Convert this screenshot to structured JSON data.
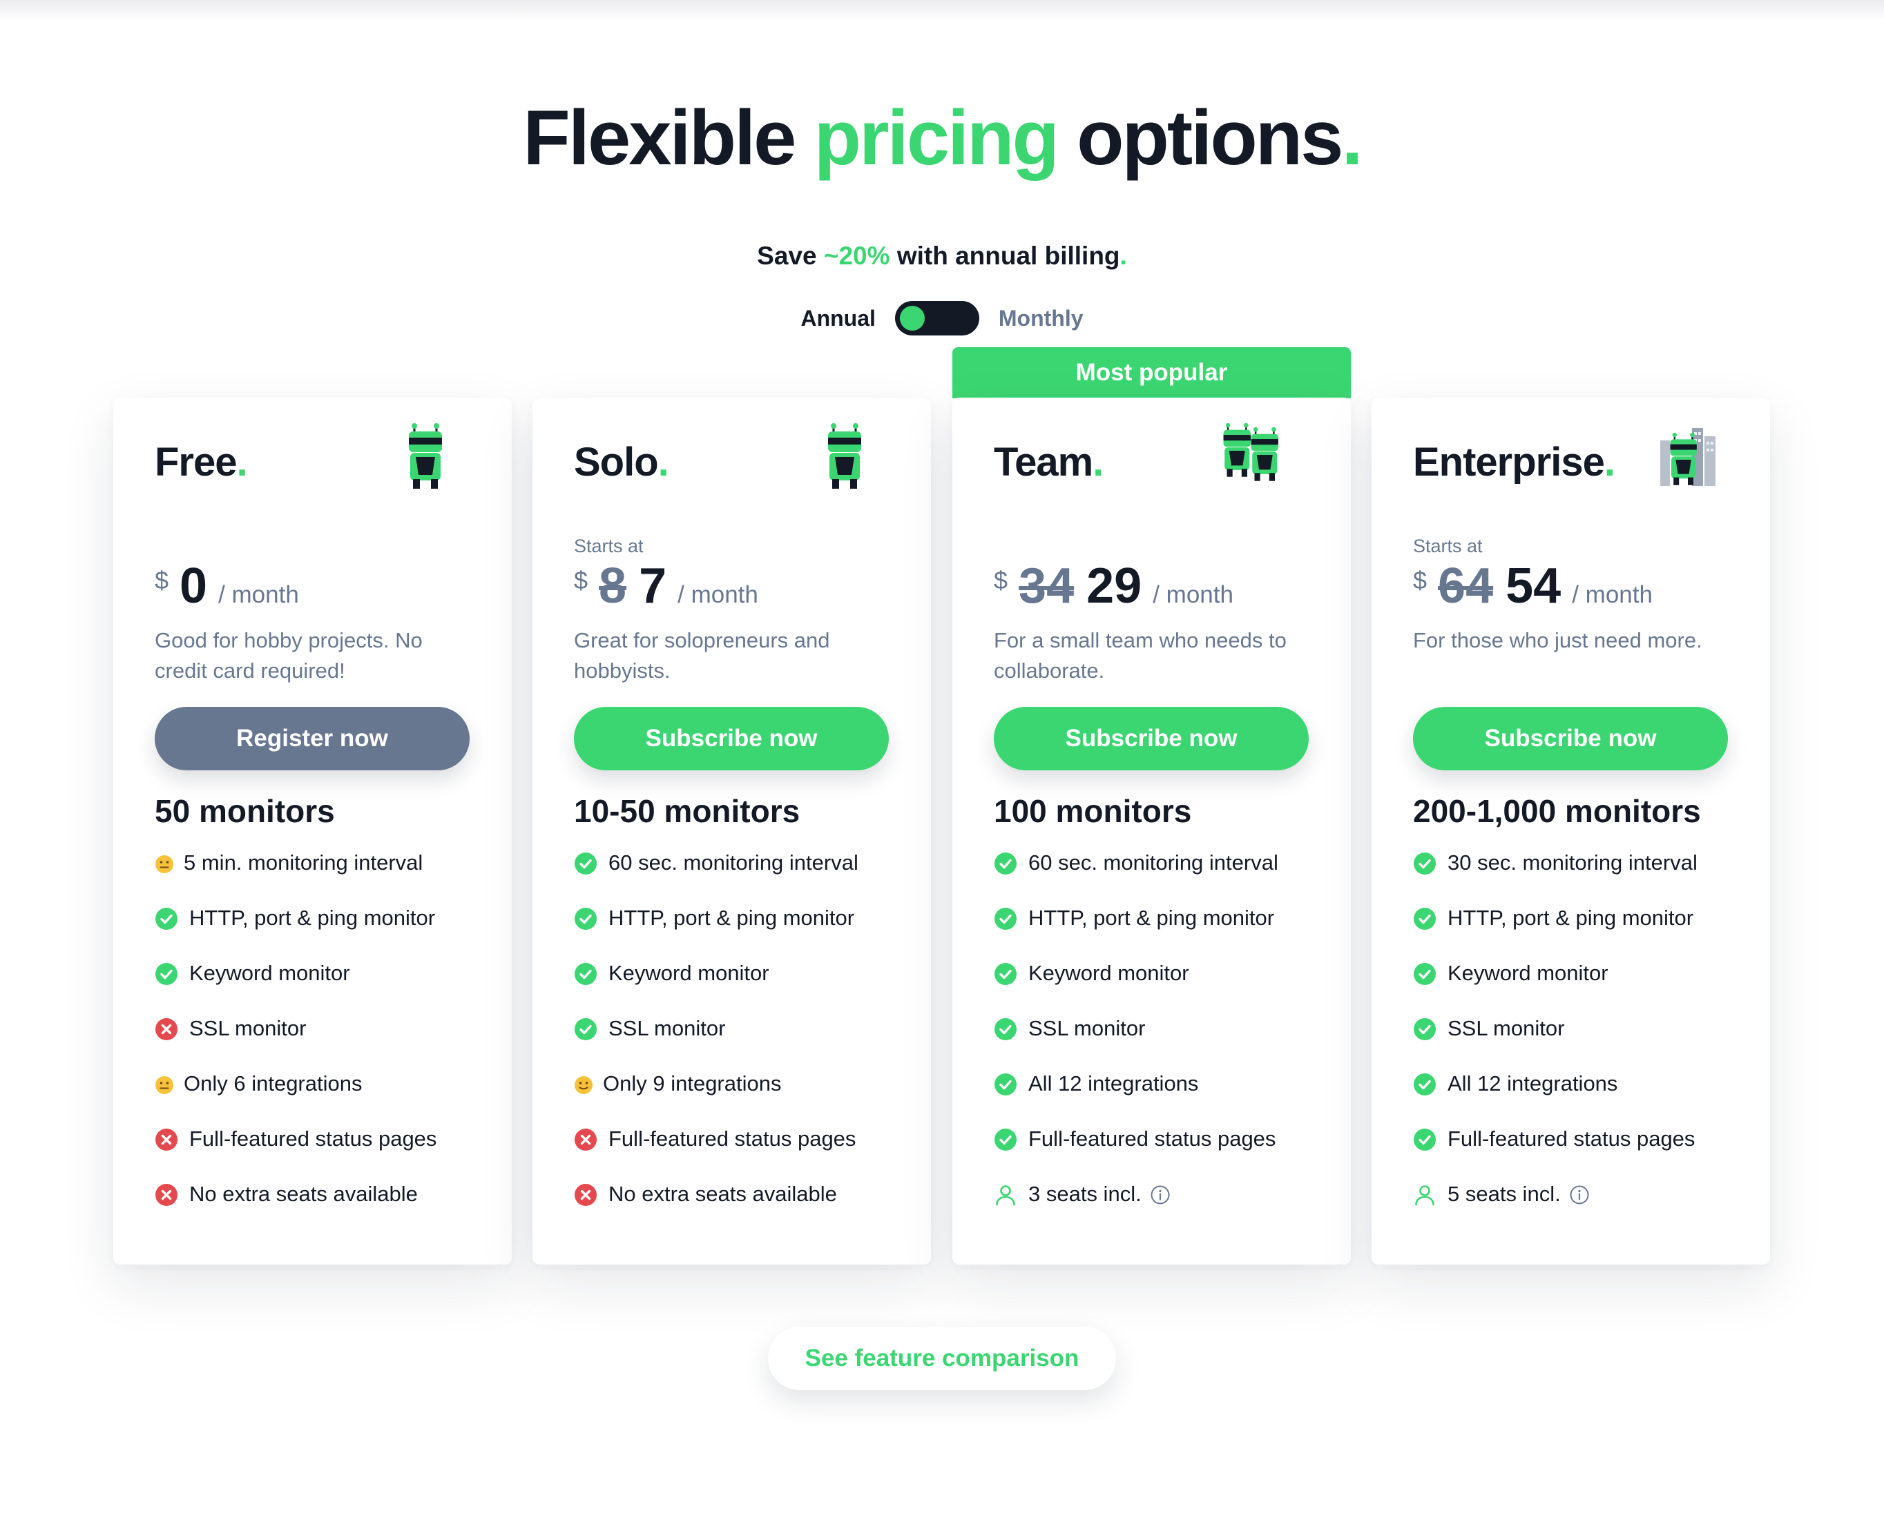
{
  "header": {
    "title_part1": "Flexible ",
    "title_accent": "pricing",
    "title_part2": " options",
    "title_dot": "."
  },
  "savings": {
    "prefix": "Save ",
    "percent": "~20%",
    "suffix": " with annual billing",
    "dot": "."
  },
  "billing_toggle": {
    "annual_label": "Annual",
    "monthly_label": "Monthly",
    "selected": "Annual"
  },
  "colors": {
    "accent": "#3bd671",
    "text_dark": "#131a26",
    "text_muted": "#687790",
    "error": "#e5484d",
    "neutral": "#f5b72a"
  },
  "plans": [
    {
      "name": "Free",
      "dot": ".",
      "mascot_icon": "robot-icon",
      "starts_at": "",
      "currency": "$",
      "old_price": "",
      "price": "0",
      "period": "/ month",
      "description": "Good for hobby projects. No credit card required!",
      "cta": "Register now",
      "monitors": "50 monitors",
      "features": [
        {
          "icon": "neutral-face-icon",
          "text": "5 min. monitoring interval"
        },
        {
          "icon": "check-icon",
          "text": "HTTP, port & ping monitor"
        },
        {
          "icon": "check-icon",
          "text": "Keyword monitor"
        },
        {
          "icon": "cross-icon",
          "text": "SSL monitor"
        },
        {
          "icon": "neutral-face-icon",
          "text": "Only 6 integrations"
        },
        {
          "icon": "cross-icon",
          "text": "Full-featured status pages"
        },
        {
          "icon": "cross-icon",
          "text": "No extra seats available"
        }
      ]
    },
    {
      "name": "Solo",
      "dot": ".",
      "mascot_icon": "robot-icon",
      "starts_at": "Starts at",
      "currency": "$",
      "old_price": "8",
      "price": "7",
      "period": "/ month",
      "description": "Great for solopreneurs and hobbyists.",
      "cta": "Subscribe now",
      "monitors": "10-50 monitors",
      "features": [
        {
          "icon": "check-icon",
          "text": "60 sec. monitoring interval"
        },
        {
          "icon": "check-icon",
          "text": "HTTP, port & ping monitor"
        },
        {
          "icon": "check-icon",
          "text": "Keyword monitor"
        },
        {
          "icon": "check-icon",
          "text": "SSL monitor"
        },
        {
          "icon": "smile-face-icon",
          "text": "Only 9 integrations"
        },
        {
          "icon": "cross-icon",
          "text": "Full-featured status pages"
        },
        {
          "icon": "cross-icon",
          "text": "No extra seats available"
        }
      ]
    },
    {
      "name": "Team",
      "dot": ".",
      "mascot_icon": "robot-team-icon",
      "badge": "Most popular",
      "starts_at": "",
      "currency": "$",
      "old_price": "34",
      "price": "29",
      "period": "/ month",
      "description": "For a small team who needs to collaborate.",
      "cta": "Subscribe now",
      "monitors": "100 monitors",
      "features": [
        {
          "icon": "check-icon",
          "text": "60 sec. monitoring interval"
        },
        {
          "icon": "check-icon",
          "text": "HTTP, port & ping monitor"
        },
        {
          "icon": "check-icon",
          "text": "Keyword monitor"
        },
        {
          "icon": "check-icon",
          "text": "SSL monitor"
        },
        {
          "icon": "check-icon",
          "text": "All 12 integrations"
        },
        {
          "icon": "check-icon",
          "text": "Full-featured status pages"
        },
        {
          "icon": "user-icon",
          "text": "3 seats incl.",
          "info": true
        }
      ]
    },
    {
      "name": "Enterprise",
      "dot": ".",
      "mascot_icon": "robot-enterprise-icon",
      "starts_at": "Starts at",
      "currency": "$",
      "old_price": "64",
      "price": "54",
      "period": "/ month",
      "description": "For those who just need more.",
      "cta": "Subscribe now",
      "monitors": "200-1,000 monitors",
      "features": [
        {
          "icon": "check-icon",
          "text": "30 sec. monitoring interval"
        },
        {
          "icon": "check-icon",
          "text": "HTTP, port & ping monitor"
        },
        {
          "icon": "check-icon",
          "text": "Keyword monitor"
        },
        {
          "icon": "check-icon",
          "text": "SSL monitor"
        },
        {
          "icon": "check-icon",
          "text": "All 12 integrations"
        },
        {
          "icon": "check-icon",
          "text": "Full-featured status pages"
        },
        {
          "icon": "user-icon",
          "text": "5 seats incl.",
          "info": true
        }
      ]
    }
  ],
  "comparison_link": "See feature comparison"
}
